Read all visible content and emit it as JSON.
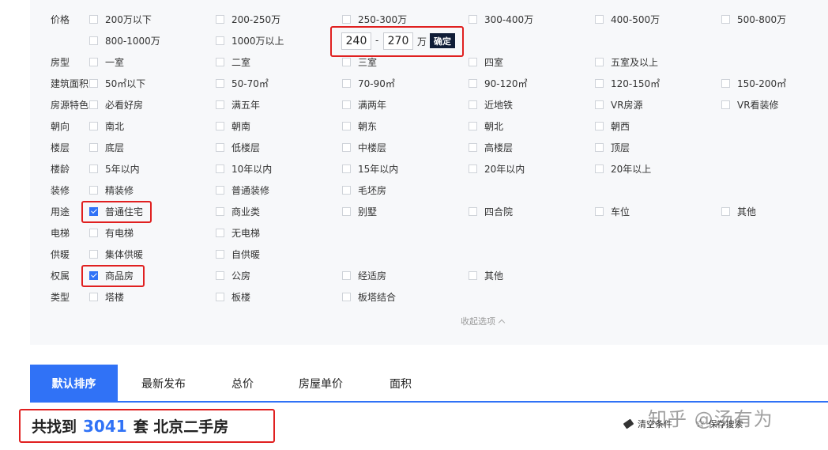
{
  "filters": {
    "price": {
      "label": "价格",
      "options": [
        "200万以下",
        "200-250万",
        "250-300万",
        "300-400万",
        "400-500万",
        "500-800万",
        "800-1000万",
        "1000万以上"
      ],
      "min": "240",
      "max": "270",
      "dash": "-",
      "unit": "万",
      "confirm": "确定"
    },
    "rooms": {
      "label": "房型",
      "options": [
        "一室",
        "二室",
        "三室",
        "四室",
        "五室及以上"
      ]
    },
    "area": {
      "label": "建筑面积",
      "options": [
        "50㎡以下",
        "50-70㎡",
        "70-90㎡",
        "90-120㎡",
        "120-150㎡",
        "150-200㎡"
      ]
    },
    "features": {
      "label": "房源特色",
      "options": [
        "必看好房",
        "满五年",
        "满两年",
        "近地铁",
        "VR房源",
        "VR看装修"
      ]
    },
    "orientation": {
      "label": "朝向",
      "options": [
        "南北",
        "朝南",
        "朝东",
        "朝北",
        "朝西"
      ]
    },
    "floor": {
      "label": "楼层",
      "options": [
        "底层",
        "低楼层",
        "中楼层",
        "高楼层",
        "顶层"
      ]
    },
    "age": {
      "label": "楼龄",
      "options": [
        "5年以内",
        "10年以内",
        "15年以内",
        "20年以内",
        "20年以上"
      ]
    },
    "decoration": {
      "label": "装修",
      "options": [
        "精装修",
        "普通装修",
        "毛坯房"
      ]
    },
    "usage": {
      "label": "用途",
      "options": [
        "普通住宅",
        "商业类",
        "别墅",
        "四合院",
        "车位",
        "其他"
      ]
    },
    "elevator": {
      "label": "电梯",
      "options": [
        "有电梯",
        "无电梯"
      ]
    },
    "heating": {
      "label": "供暖",
      "options": [
        "集体供暖",
        "自供暖"
      ]
    },
    "ownership": {
      "label": "权属",
      "options": [
        "商品房",
        "公房",
        "经适房",
        "其他"
      ]
    },
    "building_type": {
      "label": "类型",
      "options": [
        "塔楼",
        "板楼",
        "板塔结合"
      ]
    },
    "collapse": "收起选项"
  },
  "sort": {
    "tabs": [
      "默认排序",
      "最新发布",
      "总价",
      "房屋单价",
      "面积"
    ]
  },
  "result": {
    "prefix": "共找到",
    "count": "3041",
    "suffix": "套 北京二手房"
  },
  "actions": {
    "clear": "清空条件",
    "save": "保存搜索"
  },
  "watermark": "知乎 @汤有为",
  "colors": {
    "accent": "#3072f6",
    "highlight_box": "#e02020",
    "confirm_bg": "#101d37"
  }
}
